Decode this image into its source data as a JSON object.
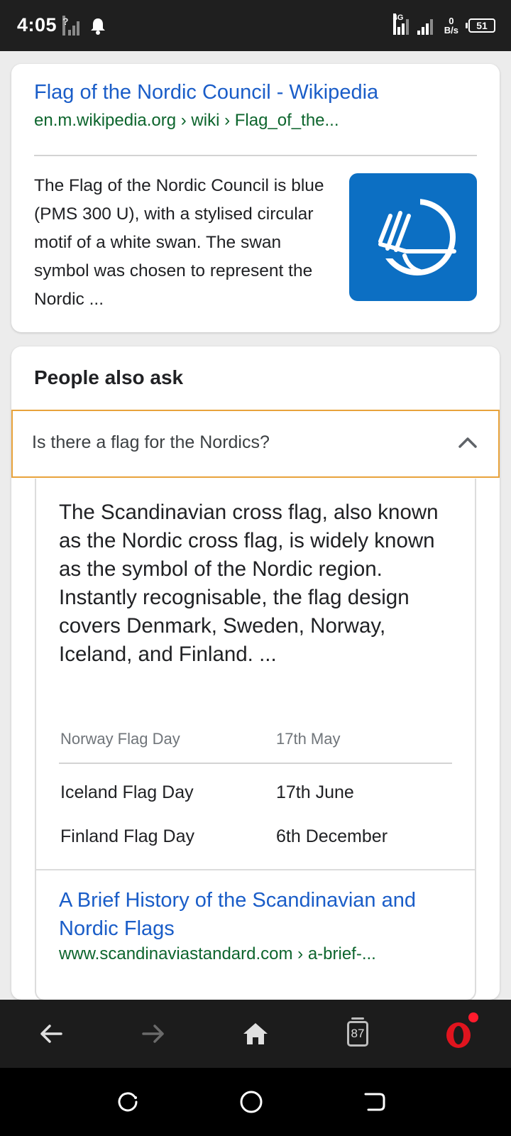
{
  "status_bar": {
    "time": "4:05",
    "network_type": "4G",
    "speed_value": "0",
    "speed_unit": "B/s",
    "battery": "51"
  },
  "result": {
    "title": "Flag of the Nordic Council - Wikipedia",
    "url": "en.m.wikipedia.org › wiki › Flag_of_the...",
    "snippet": "The Flag of the Nordic Council is blue (PMS 300 U), with a stylised circular motif of a white swan. The swan symbol was chosen to represent the Nordic ...",
    "thumbnail_icon": "nordic-swan-logo",
    "thumbnail_color": "#0c6fc3"
  },
  "people_also_ask": {
    "heading": "People also ask",
    "question": "Is there a flag for the Nordics?",
    "answer": "The Scandinavian cross flag, also known as the Nordic cross flag, is widely known as the symbol of the Nordic region. Instantly recognisable, the flag design covers Denmark, Sweden, Norway, Iceland, and Finland. ...",
    "table": {
      "header": [
        "Norway Flag Day",
        "17th May"
      ],
      "rows": [
        [
          "Iceland Flag Day",
          "17th June"
        ],
        [
          "Finland Flag Day",
          "6th December"
        ]
      ]
    },
    "source_title": "A Brief History of the Scandinavian and Nordic Flags",
    "source_url": "www.scandinaviastandard.com › a-brief-..."
  },
  "browser_bar": {
    "tab_count": "87",
    "accent": "#ff1b2d"
  },
  "colors": {
    "link": "#1a5dc8",
    "url": "#0d652d",
    "highlight_border": "#e8a33c"
  }
}
